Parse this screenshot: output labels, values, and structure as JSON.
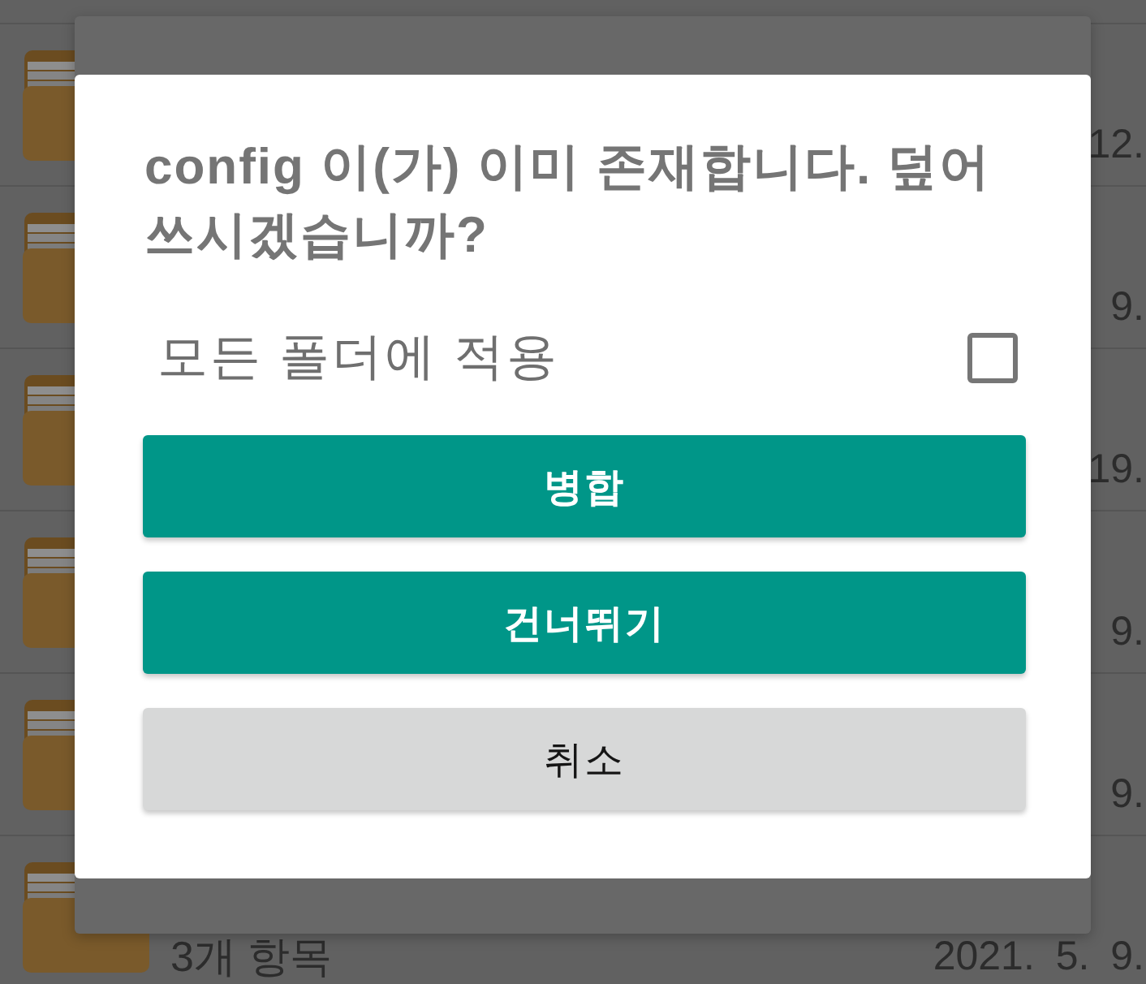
{
  "file_list": {
    "rows": [
      {
        "date": "12."
      },
      {
        "date": "9."
      },
      {
        "date": "19."
      },
      {
        "date": "9."
      },
      {
        "date": "9."
      },
      {
        "item_count": "3개 항목",
        "date": "2021. 5. 9."
      }
    ]
  },
  "dialog": {
    "title": "config 이(가) 이미 존재합니다. 덮어 쓰시겠습니까?",
    "apply_to_all": {
      "label": "모든 폴더에 적용",
      "checked": false
    },
    "buttons": [
      {
        "label": "병합",
        "kind": "primary"
      },
      {
        "label": "건너뛰기",
        "kind": "primary"
      },
      {
        "label": "취소",
        "kind": "secondary"
      }
    ]
  }
}
